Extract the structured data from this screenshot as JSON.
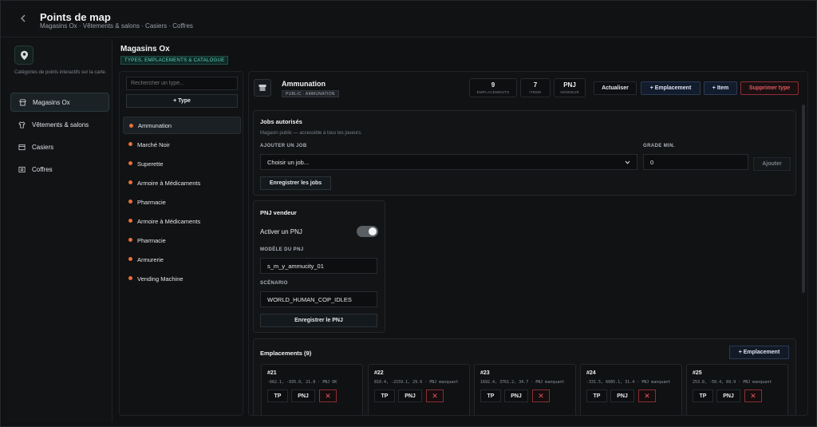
{
  "header": {
    "title": "Points de map",
    "subtitle": "Magasins Ox · Vêtements & salons · Casiers · Coffres"
  },
  "nav": {
    "description": "Catégories de points interactifs sur la carte.",
    "items": [
      {
        "label": "Magasins Ox",
        "icon": "store-icon"
      },
      {
        "label": "Vêtements & salons",
        "icon": "shirt-icon"
      },
      {
        "label": "Casiers",
        "icon": "locker-icon"
      },
      {
        "label": "Coffres",
        "icon": "safe-icon"
      }
    ]
  },
  "section": {
    "title": "Magasins Ox",
    "tag": "TYPES, EMPLACEMENTS & CATALOGUE"
  },
  "types": {
    "search_placeholder": "Rechercher un type...",
    "add_label": "+ Type",
    "items": [
      "Ammunation",
      "Marché Noir",
      "Superette",
      "Armoire à Médicaments",
      "Pharmacie",
      "Armoire à Médicaments",
      "Pharmacie",
      "Armurerie",
      "Vending Machine"
    ]
  },
  "detail": {
    "title": "Ammunation",
    "badge": "PUBLIC · AMMUNATION",
    "stats": [
      {
        "value": "9",
        "label": "EMPLACEMENTS"
      },
      {
        "value": "7",
        "label": "ITEMS"
      },
      {
        "value": "PNJ",
        "label": "VENDEUR"
      }
    ],
    "buttons": {
      "refresh": "Actualiser",
      "add_location": "+ Emplacement",
      "add_item": "+ Item",
      "delete_type": "Supprimer type"
    }
  },
  "jobs": {
    "title": "Jobs autorisés",
    "description": "Magasin public — accessible à tous les joueurs.",
    "add_job_label": "AJOUTER UN JOB",
    "job_select_value": "Choisir un job...",
    "grade_label": "GRADE MIN.",
    "grade_value": "0",
    "add_button": "Ajouter",
    "save_button": "Enregistrer les jobs"
  },
  "npc": {
    "title": "PNJ vendeur",
    "enable_label": "Activer un PNJ",
    "enabled": true,
    "model_label": "MODÈLE DU PNJ",
    "model_value": "s_m_y_ammucity_01",
    "scenario_label": "SCÉNARIO",
    "scenario_value": "WORLD_HUMAN_COP_IDLES",
    "save_button": "Enregistrer le PNJ"
  },
  "locations": {
    "title": "Emplacements (9)",
    "add_button": "+ Emplacement",
    "tp_label": "TP",
    "npc_label": "PNJ",
    "delete_symbol": "✕",
    "items": [
      {
        "num": "#21",
        "coords": "-662.1, -935.0, 21.8 · PNJ OK"
      },
      {
        "num": "#22",
        "coords": "810.4, -2159.1, 29.6 · PNJ manquant"
      },
      {
        "num": "#23",
        "coords": "1692.4, 3761.2, 34.7 · PNJ manquant"
      },
      {
        "num": "#24",
        "coords": "-331.5, 6085.1, 31.4 · PNJ manquant"
      },
      {
        "num": "#25",
        "coords": "253.8, -50.4, 69.9 · PNJ manquant"
      }
    ]
  }
}
